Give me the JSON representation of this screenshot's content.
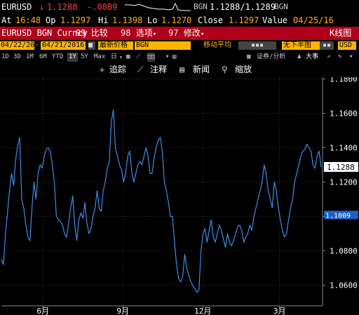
{
  "quote": {
    "ticker": "EURUSD",
    "arrow": "↓",
    "last": "1.1288",
    "change": "-.0009",
    "source": "BGN",
    "bidask": "1.1288/1.1289",
    "source2": "BGN"
  },
  "stats": {
    "time_label": "At",
    "time": "16:48",
    "open_label": "Op",
    "open": "1.1297",
    "high_label": "Hi",
    "high": "1.1398",
    "low_label": "Lo",
    "low": "1.1270",
    "close_label": "Close",
    "close": "1.1297",
    "value_label": "Value",
    "value_date": "04/25/16"
  },
  "menubar": {
    "security": "EURUSD BGN Curncy",
    "items": [
      {
        "num": "99",
        "label": "比较"
      },
      {
        "num": "98",
        "label": "选项"
      },
      {
        "num": "97",
        "label": "修改"
      }
    ],
    "right_label": "K线图"
  },
  "settings": {
    "start_date": "04/22/2015",
    "end_date": "04/21/2016",
    "price_field": "最新价格",
    "source": "BGN",
    "indicator": "移动平均",
    "panel": "无下半图",
    "currency": "USD"
  },
  "periods": {
    "items": [
      "1D",
      "3D",
      "1M",
      "6M",
      "YTD",
      "1Y",
      "5Y",
      "Max"
    ],
    "active": "1Y",
    "freq": "日",
    "right_labels": [
      "证券/分析",
      "大事"
    ]
  },
  "tools": {
    "track": "追踪",
    "annotate": "注释",
    "news": "新闻",
    "zoom": "缩放"
  },
  "colors": {
    "bg": "#000000",
    "menu_red": "#b0001a",
    "line": "#3b8ee8",
    "down": "#ff4040",
    "accent_orange": "#ffb400",
    "last_box": "#ffffff",
    "avg_box": "#1d5fc0"
  },
  "chart_data": {
    "type": "line",
    "series": [
      {
        "name": "",
        "values": [
          1.075,
          1.072,
          1.09,
          1.102,
          1.115,
          1.125,
          1.118,
          1.133,
          1.141,
          1.146,
          1.11,
          1.105,
          1.095,
          1.088,
          1.086,
          1.105,
          1.12,
          1.11,
          1.125,
          1.13,
          1.128,
          1.135,
          1.139,
          1.14,
          1.138,
          1.13,
          1.12,
          1.1,
          1.098,
          1.097,
          1.095,
          1.09,
          1.088,
          1.096,
          1.105,
          1.112,
          1.095,
          1.086,
          1.098,
          1.102,
          1.099,
          1.108,
          1.096,
          1.09,
          1.093,
          1.1,
          1.105,
          1.115,
          1.105,
          1.103,
          1.115,
          1.12,
          1.128,
          1.132,
          1.155,
          1.162,
          1.14,
          1.135,
          1.13,
          1.127,
          1.12,
          1.125,
          1.135,
          1.138,
          1.126,
          1.12,
          1.125,
          1.13,
          1.132,
          1.13,
          1.135,
          1.14,
          1.135,
          1.125,
          1.125,
          1.134,
          1.14,
          1.144,
          1.146,
          1.138,
          1.12,
          1.115,
          1.108,
          1.1,
          1.1,
          1.085,
          1.072,
          1.064,
          1.062,
          1.065,
          1.078,
          1.07,
          1.066,
          1.062,
          1.06,
          1.058,
          1.056,
          1.057,
          1.08,
          1.09,
          1.093,
          1.085,
          1.092,
          1.098,
          1.088,
          1.085,
          1.09,
          1.095,
          1.092,
          1.087,
          1.082,
          1.09,
          1.085,
          1.083,
          1.086,
          1.09,
          1.094,
          1.095,
          1.092,
          1.085,
          1.088,
          1.09,
          1.095,
          1.092,
          1.1,
          1.105,
          1.11,
          1.115,
          1.12,
          1.13,
          1.125,
          1.115,
          1.11,
          1.105,
          1.12,
          1.115,
          1.105,
          1.098,
          1.092,
          1.088,
          1.09,
          1.098,
          1.105,
          1.11,
          1.12,
          1.125,
          1.13,
          1.135,
          1.138,
          1.139,
          1.142,
          1.14,
          1.138,
          1.13,
          1.128,
          1.135,
          1.138,
          1.1288
        ]
      }
    ],
    "x_ticks": [
      "6月",
      "9月",
      "12月",
      "3月"
    ],
    "y_ticks": [
      "1.1800",
      "1.1600",
      "1.1400",
      "1.1200",
      "1.1000",
      "1.0800",
      "1.0600"
    ],
    "ylim": [
      1.048,
      1.181
    ],
    "last_label": "1.1288",
    "avg_label": "1.1009",
    "avg_value": 1.1009,
    "grid": true
  }
}
